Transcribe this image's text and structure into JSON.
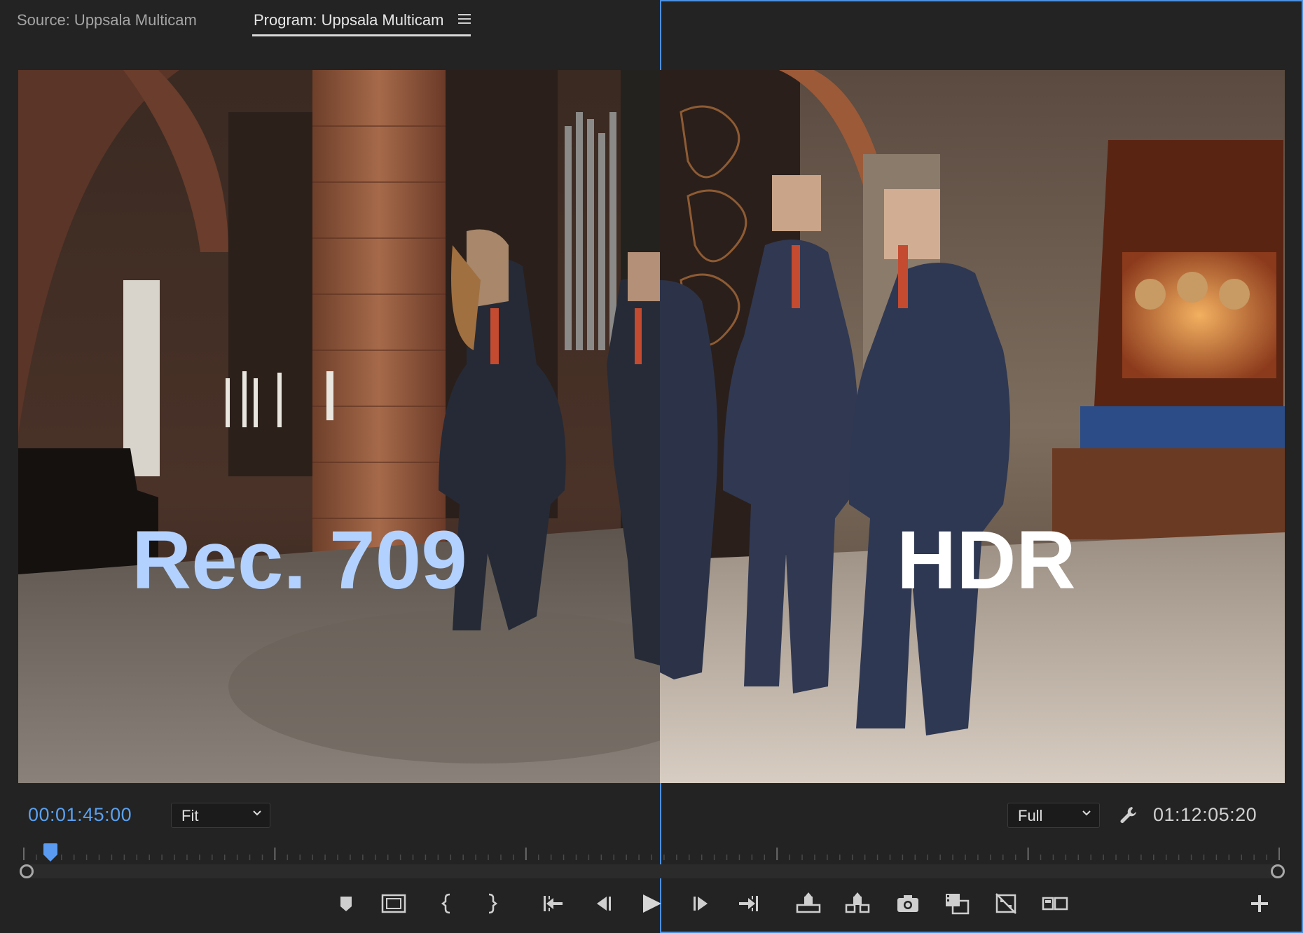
{
  "tabs": {
    "source": "Source: Uppsala Multicam",
    "program": "Program: Uppsala Multicam"
  },
  "viewer": {
    "left_label": "Rec. 709",
    "right_label": "HDR"
  },
  "timecode": {
    "current": "00:01:45:00",
    "duration": "01:12:05:20"
  },
  "zoom_level": "Fit",
  "resolution": "Full",
  "playhead_position": 0.015,
  "colors": {
    "background": "#232323",
    "accent_blue": "#4c8fe0",
    "timecode_blue": "#5aa0ef",
    "rec709_label": "#b3d1ff",
    "hdr_label": "#ffffff"
  },
  "controls": [
    "add-marker-icon",
    "safe-margins-icon",
    "mark-in-icon",
    "mark-out-icon",
    "go-to-in-icon",
    "step-back-icon",
    "play-icon",
    "step-forward-icon",
    "go-to-out-icon",
    "lift-icon",
    "extract-icon",
    "export-frame-icon",
    "comparison-view-icon",
    "toggle-proxies-icon",
    "multicam-view-icon",
    "button-editor-icon"
  ]
}
